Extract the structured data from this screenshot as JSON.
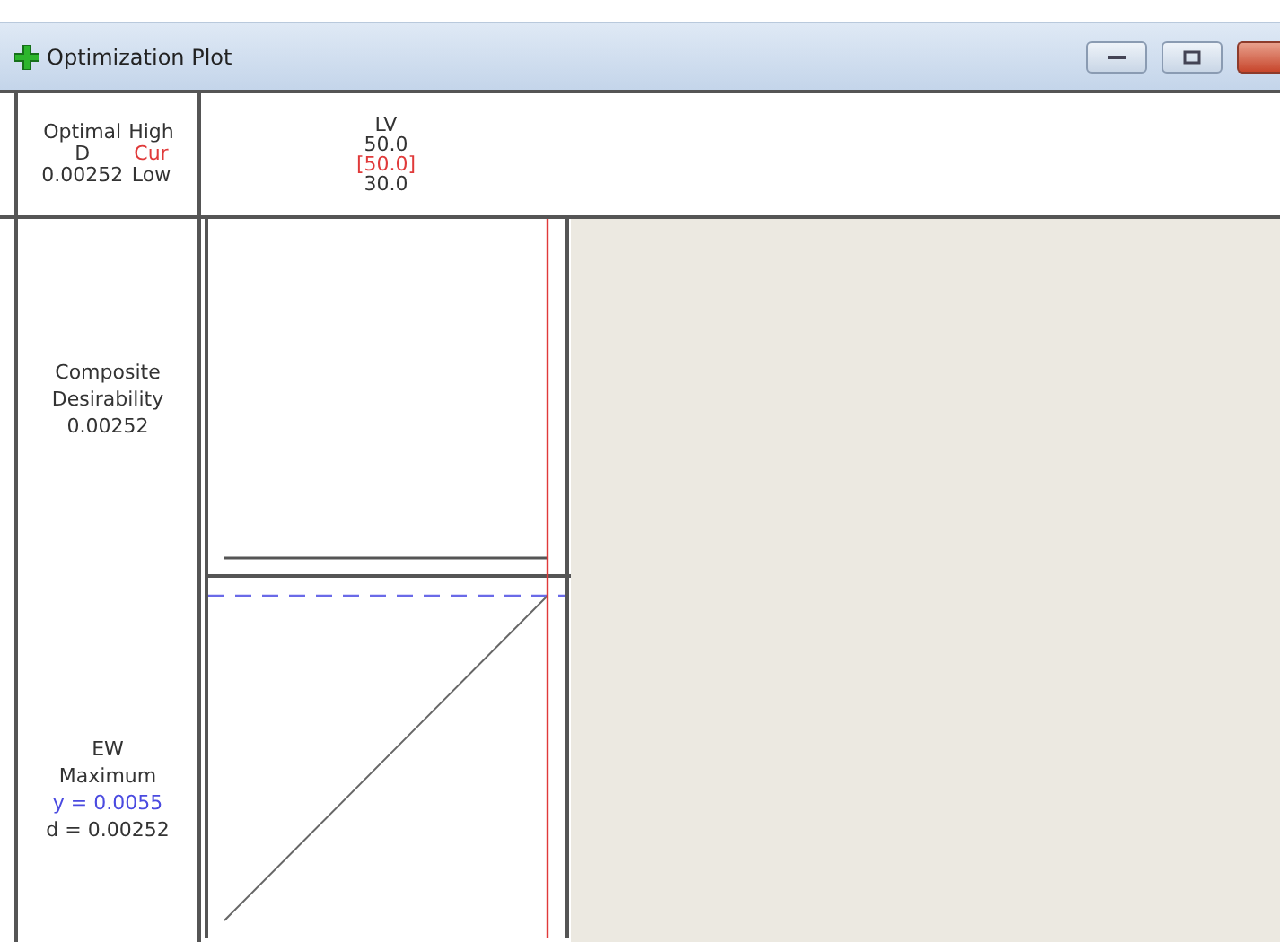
{
  "window": {
    "title": "Optimization Plot"
  },
  "header": {
    "optimal_label": "Optimal",
    "d_label": "D",
    "d_value": "0.00252",
    "row_labels": [
      {
        "text": "High",
        "kind": "high"
      },
      {
        "text": "Cur",
        "kind": "current"
      },
      {
        "text": "Low",
        "kind": "low"
      }
    ]
  },
  "factors": [
    {
      "name": "LV",
      "high": "50.0",
      "current": "[50.0]",
      "low": "30.0"
    }
  ],
  "composite": {
    "lines": [
      "Composite",
      "Desirability",
      "0.00252"
    ]
  },
  "responses": [
    {
      "name": "EW",
      "goal": "Maximum",
      "y": "y = 0.0055",
      "d": "d = 0.00252"
    }
  ]
}
